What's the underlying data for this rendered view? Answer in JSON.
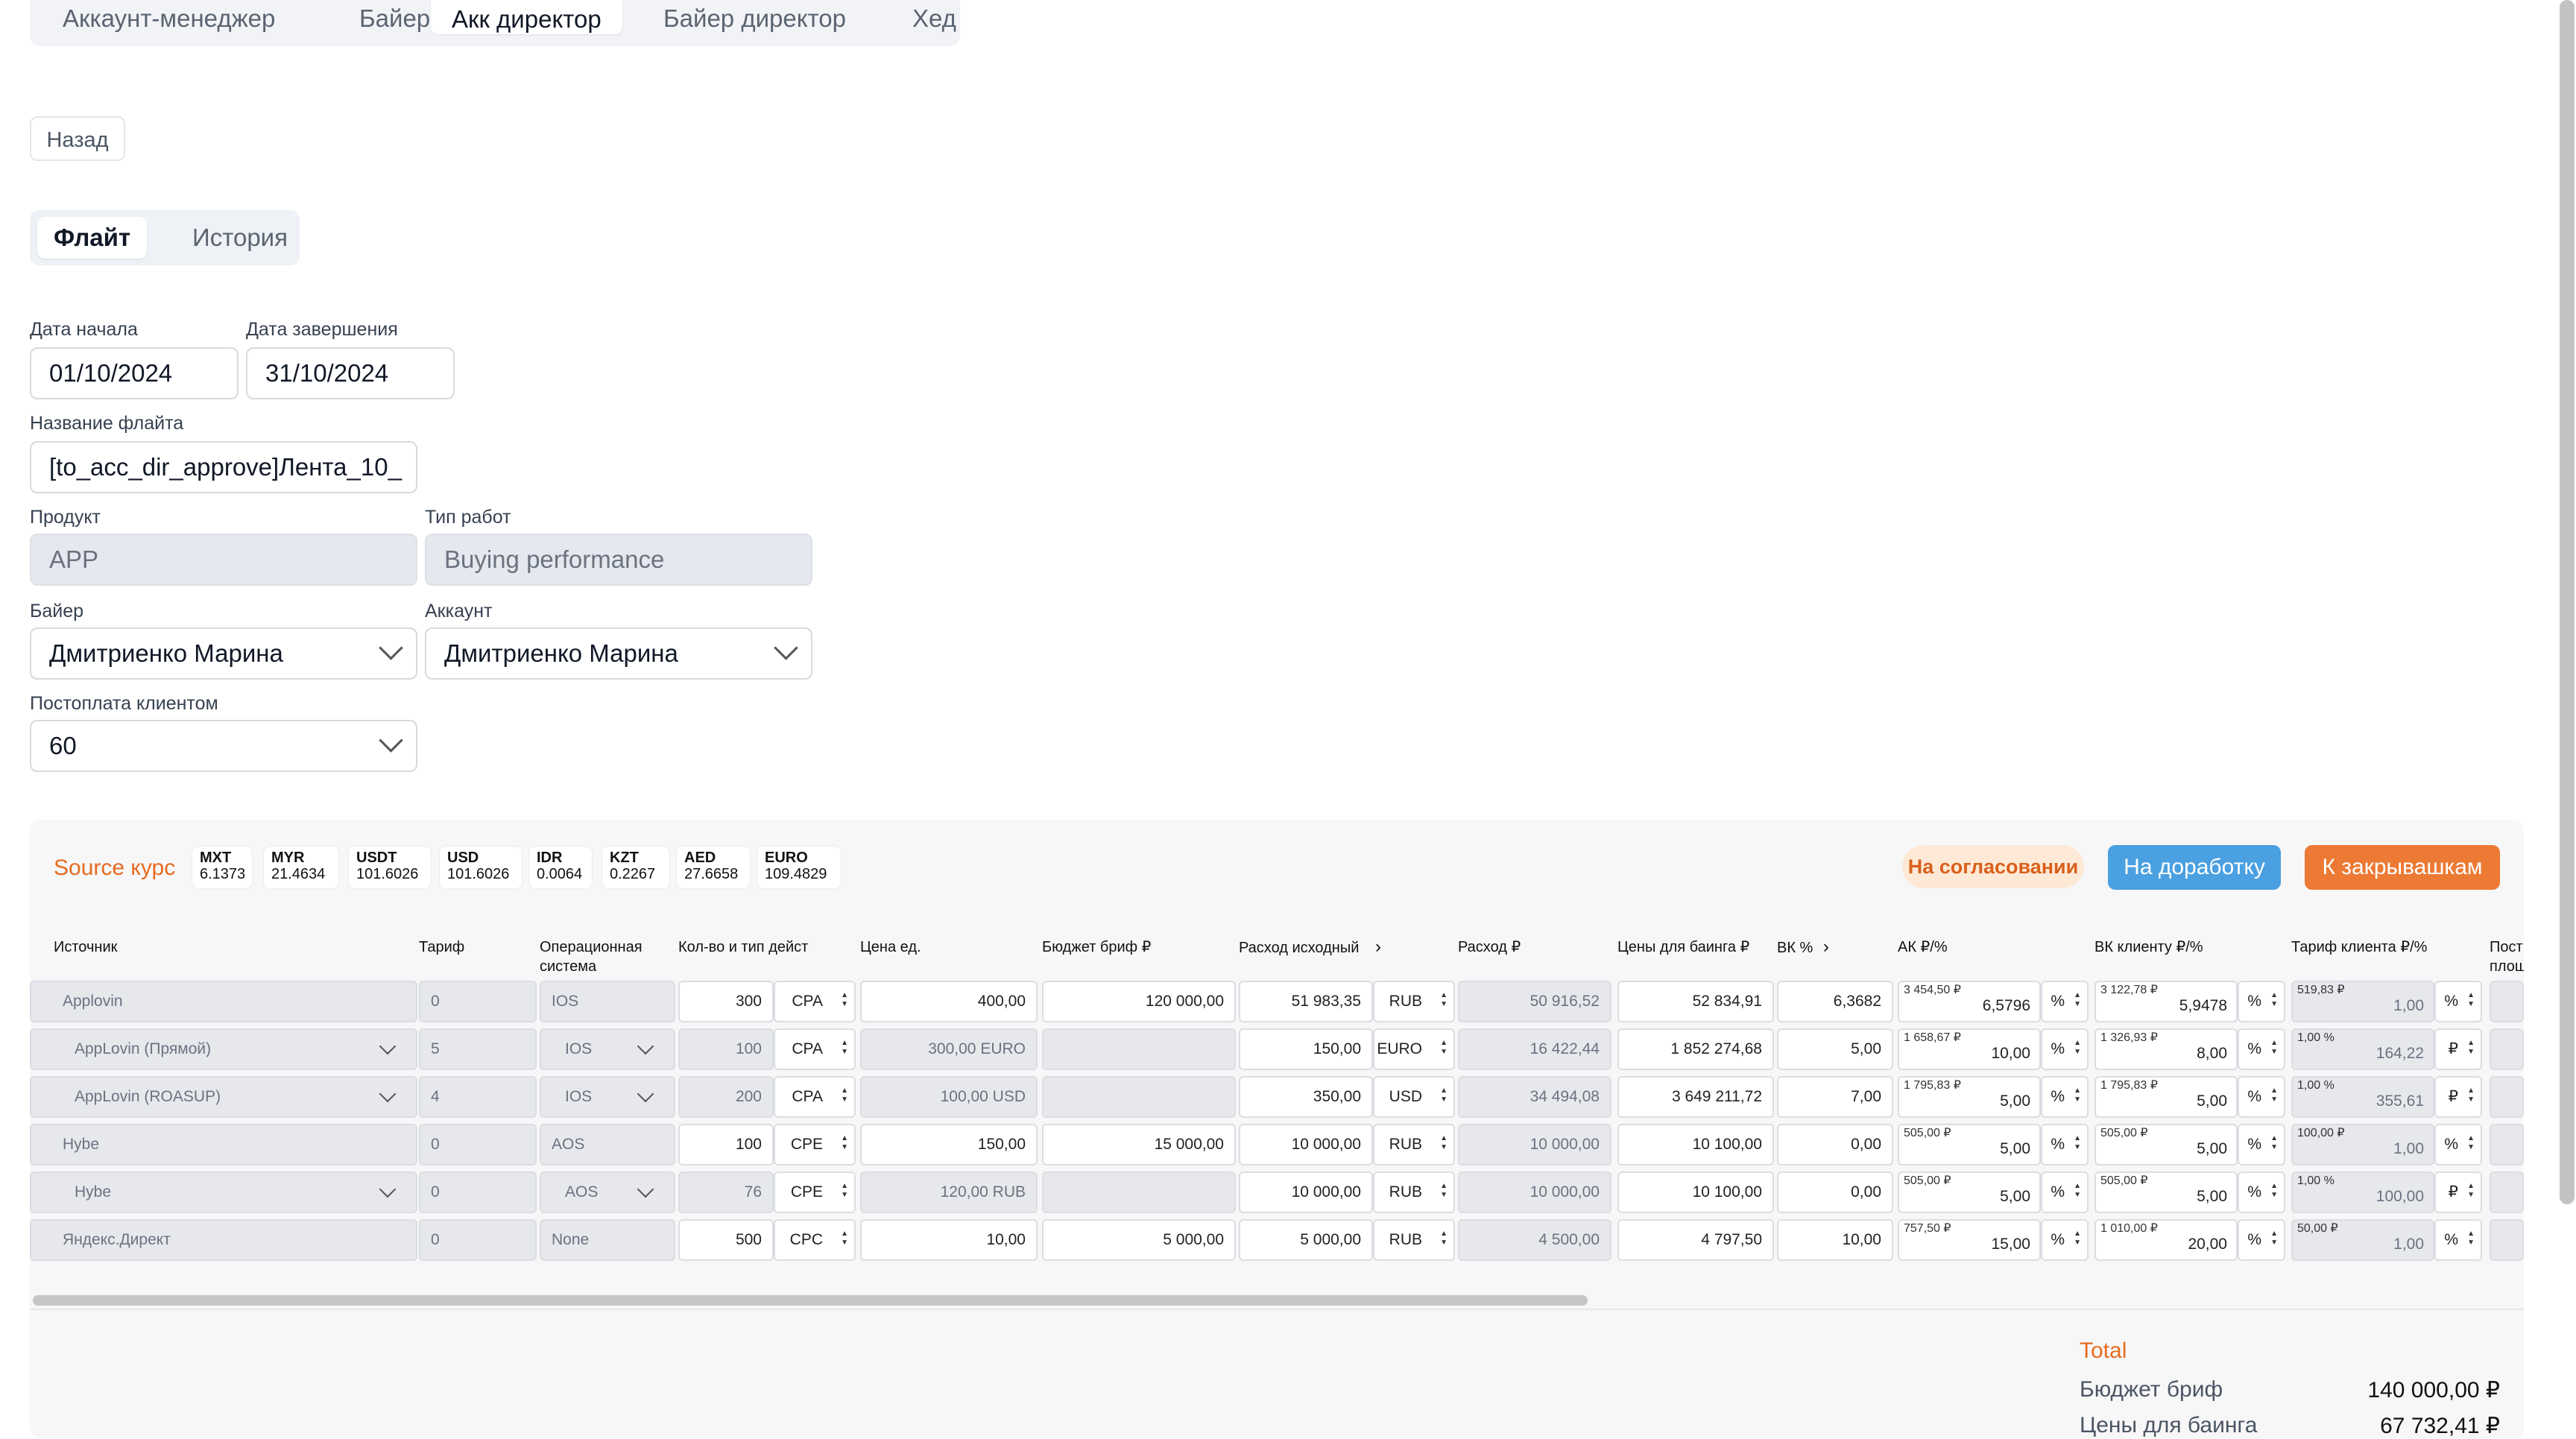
{
  "role_tabs": [
    "Аккаунт-менеджер",
    "Байер",
    "Акк директор",
    "Байер директор",
    "Хед"
  ],
  "active_role_tab": "Акк директор",
  "back_label": "Назад",
  "view_tabs": [
    "Флайт",
    "История"
  ],
  "form": {
    "start_label": "Дата начала",
    "start_value": "01/10/2024",
    "end_label": "Дата завершения",
    "end_value": "31/10/2024",
    "flight_name_label": "Название флайта",
    "flight_name_value": "[to_acc_dir_approve]Лента_10_",
    "product_label": "Продукт",
    "product_value": "APP",
    "work_type_label": "Тип работ",
    "work_type_value": "Buying performance",
    "buyer_label": "Байер",
    "buyer_value": "Дмитриенко Марина",
    "account_label": "Аккаунт",
    "account_value": "Дмитриенко Марина",
    "postpay_label": "Постоплата клиентом",
    "postpay_value": "60"
  },
  "source_rate_label": "Source курс",
  "rates": [
    {
      "code": "MXT",
      "value": "6.1373"
    },
    {
      "code": "MYR",
      "value": "21.4634"
    },
    {
      "code": "USDT",
      "value": "101.6026"
    },
    {
      "code": "USD",
      "value": "101.6026"
    },
    {
      "code": "IDR",
      "value": "0.0064"
    },
    {
      "code": "KZT",
      "value": "0.2267"
    },
    {
      "code": "AED",
      "value": "27.6658"
    },
    {
      "code": "EURO",
      "value": "109.4829"
    }
  ],
  "status_badge": "На согласовании",
  "rework_button": "На доработку",
  "close_button": "К закрывашкам",
  "columns": {
    "source": "Источник",
    "tariff": "Тариф",
    "os_1": "Операционная",
    "os_2": "система",
    "qty": "Кол-во и тип дейст",
    "unit_price": "Цена ед.",
    "budget": "Бюджет бриф ₽",
    "expense_src": "Расход исходный",
    "expense": "Расход ₽",
    "buying_price": "Цены для баинга ₽",
    "vk": "ВК %",
    "ak": "АК ₽/%",
    "vk_client": "ВК клиенту ₽/%",
    "client_tariff": "Тариф клиента ₽/%",
    "cut_1": "Пост",
    "cut_2": "площ"
  },
  "rows": [
    {
      "source": "Applovin",
      "source_dd": false,
      "tariff": "0",
      "os": "IOS",
      "os_dd": false,
      "qty": "300",
      "action": "CPA",
      "unit_price": "400,00",
      "unit_dis": false,
      "budget": "120 000,00",
      "exp_src": "51 983,35",
      "cur": "RUB",
      "expense": "50 916,52",
      "buying": "52 834,91",
      "vk": "6,3682",
      "ak_sub": "3 454,50 ₽",
      "ak": "6,5796",
      "ak_u": "%",
      "vkc_sub": "3 122,78 ₽",
      "vkc": "5,9478",
      "vkc_u": "%",
      "ct_sub": "519,83 ₽",
      "ct": "1,00",
      "ct_u": "%"
    },
    {
      "source": "AppLovin (Прямой)",
      "source_dd": true,
      "tariff": "5",
      "os": "IOS",
      "os_dd": true,
      "qty": "100",
      "action": "CPA",
      "unit_price": "300,00 EURO",
      "unit_dis": true,
      "budget": "",
      "exp_src": "150,00",
      "cur": "EURO",
      "expense": "16 422,44",
      "buying": "1 852 274,68",
      "vk": "5,00",
      "ak_sub": "1 658,67 ₽",
      "ak": "10,00",
      "ak_u": "%",
      "vkc_sub": "1 326,93 ₽",
      "vkc": "8,00",
      "vkc_u": "%",
      "ct_sub": "1,00 %",
      "ct": "164,22",
      "ct_u": "₽"
    },
    {
      "source": "AppLovin (ROASUP)",
      "source_dd": true,
      "tariff": "4",
      "os": "IOS",
      "os_dd": true,
      "qty": "200",
      "action": "CPA",
      "unit_price": "100,00 USD",
      "unit_dis": true,
      "budget": "",
      "exp_src": "350,00",
      "cur": "USD",
      "expense": "34 494,08",
      "buying": "3 649 211,72",
      "vk": "7,00",
      "ak_sub": "1 795,83 ₽",
      "ak": "5,00",
      "ak_u": "%",
      "vkc_sub": "1 795,83 ₽",
      "vkc": "5,00",
      "vkc_u": "%",
      "ct_sub": "1,00 %",
      "ct": "355,61",
      "ct_u": "₽"
    },
    {
      "source": "Hybe",
      "source_dd": false,
      "tariff": "0",
      "os": "AOS",
      "os_dd": false,
      "qty": "100",
      "action": "CPE",
      "unit_price": "150,00",
      "unit_dis": false,
      "budget": "15 000,00",
      "exp_src": "10 000,00",
      "cur": "RUB",
      "expense": "10 000,00",
      "buying": "10 100,00",
      "vk": "0,00",
      "ak_sub": "505,00 ₽",
      "ak": "5,00",
      "ak_u": "%",
      "vkc_sub": "505,00 ₽",
      "vkc": "5,00",
      "vkc_u": "%",
      "ct_sub": "100,00 ₽",
      "ct": "1,00",
      "ct_u": "%"
    },
    {
      "source": "Hybe",
      "source_dd": true,
      "tariff": "0",
      "os": "AOS",
      "os_dd": true,
      "qty": "76",
      "action": "CPE",
      "unit_price": "120,00 RUB",
      "unit_dis": true,
      "budget": "",
      "exp_src": "10 000,00",
      "cur": "RUB",
      "expense": "10 000,00",
      "buying": "10 100,00",
      "vk": "0,00",
      "ak_sub": "505,00 ₽",
      "ak": "5,00",
      "ak_u": "%",
      "vkc_sub": "505,00 ₽",
      "vkc": "5,00",
      "vkc_u": "%",
      "ct_sub": "1,00 %",
      "ct": "100,00",
      "ct_u": "₽"
    },
    {
      "source": "Яндекс.Директ",
      "source_dd": false,
      "tariff": "0",
      "os": "None",
      "os_dd": false,
      "qty": "500",
      "action": "CPC",
      "unit_price": "10,00",
      "unit_dis": false,
      "budget": "5 000,00",
      "exp_src": "5 000,00",
      "cur": "RUB",
      "expense": "4 500,00",
      "buying": "4 797,50",
      "vk": "10,00",
      "ak_sub": "757,50 ₽",
      "ak": "15,00",
      "ak_u": "%",
      "vkc_sub": "1 010,00 ₽",
      "vkc": "20,00",
      "vkc_u": "%",
      "ct_sub": "50,00 ₽",
      "ct": "1,00",
      "ct_u": "%"
    }
  ],
  "totals": {
    "title": "Total",
    "budget_label": "Бюджет бриф",
    "budget_value": "140 000,00 ₽",
    "buying_label": "Цены для баинга",
    "buying_value": "67 732,41 ₽"
  },
  "colors": {
    "accent_orange": "#e66b1f",
    "button_blue": "#4aa0e0",
    "button_orange": "#ec7a34"
  }
}
